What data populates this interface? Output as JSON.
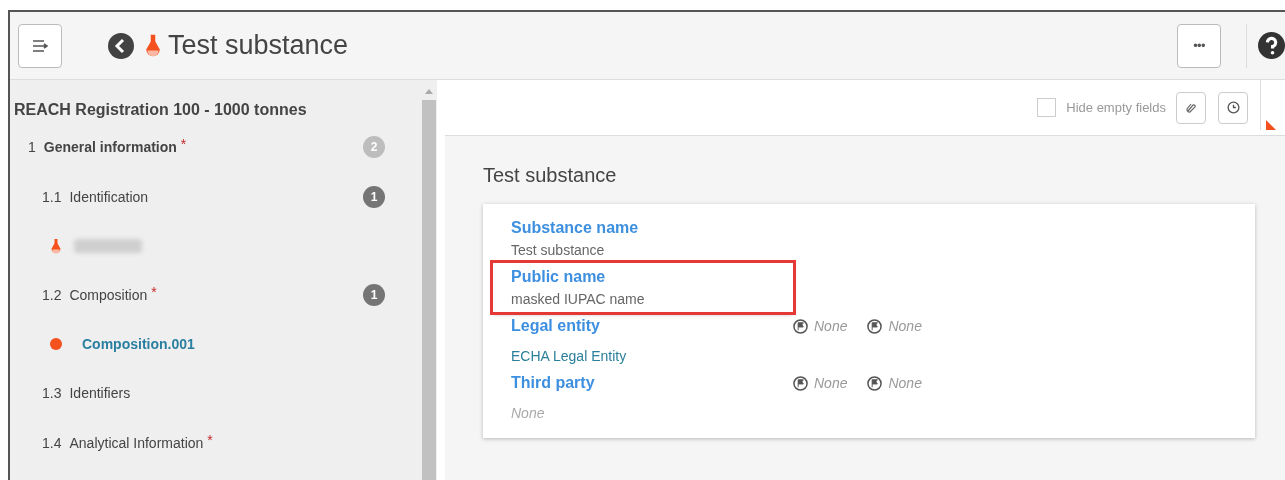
{
  "header": {
    "title": "Test substance",
    "more_button": "•••"
  },
  "sidebar": {
    "title": "REACH Registration 100 - 1000 tonnes",
    "items": [
      {
        "number": "1",
        "label": "General information",
        "required_mark": "*",
        "badge": "2",
        "badge_muted": true,
        "children": [
          {
            "number": "1.1",
            "label": "Identification",
            "badge": "1",
            "badge_muted": false,
            "children": [
              {
                "kind": "redacted"
              }
            ]
          },
          {
            "number": "1.2",
            "label": "Composition",
            "required_mark": "*",
            "badge": "1",
            "badge_muted": false,
            "children": [
              {
                "kind": "record",
                "label": "Composition.001",
                "color": "#f4511e"
              }
            ]
          },
          {
            "number": "1.3",
            "label": "Identifiers"
          },
          {
            "number": "1.4",
            "label": "Analytical Information",
            "required_mark": "*"
          }
        ]
      }
    ]
  },
  "toolbar": {
    "hide_empty_fields": {
      "label": "Hide empty fields",
      "checked": false
    }
  },
  "content": {
    "title": "Test substance",
    "fields": [
      {
        "label": "Substance name",
        "value": "Test substance",
        "kind": "text",
        "highlighted": false
      },
      {
        "label": "Public name",
        "value": "masked IUPAC name",
        "kind": "text",
        "highlighted": true
      },
      {
        "label": "Legal entity",
        "value": "ECHA Legal Entity",
        "kind": "link",
        "highlighted": false,
        "flags": [
          "None",
          "None"
        ]
      },
      {
        "label": "Third party",
        "value": "None",
        "kind": "empty",
        "highlighted": false,
        "flags": [
          "None",
          "None"
        ]
      }
    ]
  }
}
